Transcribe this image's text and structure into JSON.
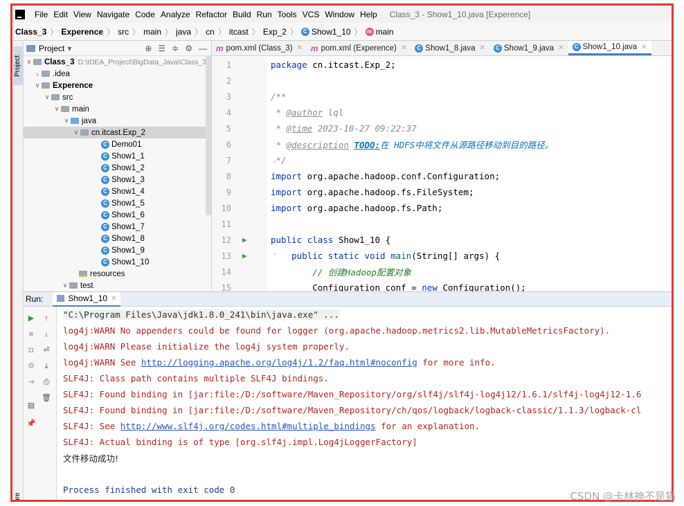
{
  "menubar": {
    "items": [
      "File",
      "Edit",
      "View",
      "Navigate",
      "Code",
      "Analyze",
      "Refactor",
      "Build",
      "Run",
      "Tools",
      "VCS",
      "Window",
      "Help"
    ],
    "window_title": "Class_3 - Show1_10.java [Experence]"
  },
  "navbar": {
    "crumbs": [
      "Class_3",
      "Experence",
      "src",
      "main",
      "java",
      "cn",
      "itcast",
      "Exp_2",
      "Show1_10",
      "main"
    ]
  },
  "sidestrip": {
    "top_label": "Project",
    "bottom_label": "ure"
  },
  "project": {
    "header": "Project",
    "dropdown": "▾",
    "tree": [
      {
        "label": "Class_3",
        "path": "D:\\IDEA_Project\\BigData_Java\\Class_3",
        "bold": true
      },
      {
        "label": ".idea"
      },
      {
        "label": "Experence",
        "bold": true
      },
      {
        "label": "src"
      },
      {
        "label": "main"
      },
      {
        "label": "java"
      },
      {
        "label": "cn.itcast.Exp_2"
      },
      {
        "label": "Demo01"
      },
      {
        "label": "Show1_1"
      },
      {
        "label": "Show1_2"
      },
      {
        "label": "Show1_3"
      },
      {
        "label": "Show1_4"
      },
      {
        "label": "Show1_5"
      },
      {
        "label": "Show1_6"
      },
      {
        "label": "Show1_7"
      },
      {
        "label": "Show1_8"
      },
      {
        "label": "Show1_9"
      },
      {
        "label": "Show1_10"
      },
      {
        "label": "resources"
      },
      {
        "label": "test"
      }
    ]
  },
  "editor": {
    "tabs": [
      {
        "label": "pom.xml (Class_3)",
        "icon": "m"
      },
      {
        "label": "pom.xml (Experence)",
        "icon": "m"
      },
      {
        "label": "Show1_8.java",
        "icon": "C"
      },
      {
        "label": "Show1_9.java",
        "icon": "C"
      },
      {
        "label": "Show1_10.java",
        "icon": "C"
      }
    ],
    "line_numbers": [
      "1",
      "2",
      "3",
      "4",
      "5",
      "6",
      "7",
      "8",
      "9",
      "10",
      "11",
      "12",
      "13",
      "14",
      "15"
    ],
    "code": {
      "l1_kw": "package",
      "l1_rest": " cn.itcast.Exp_2;",
      "l3": "/**",
      "l4_star": " * ",
      "l4_tag": "@author",
      "l4_val": " lql",
      "l5_tag": "@time",
      "l5_val": " 2023-10-27 09:22:37",
      "l6_tag": "@description",
      "l6_todo": "TODO:",
      "l6_text": "在 HDFS中将文件从源路径移动到目的路径。",
      "l7": " */",
      "l8_kw": "import",
      "l8_rest": " org.apache.hadoop.conf.Configuration;",
      "l9_kw": "import",
      "l9_rest": " org.apache.hadoop.fs.FileSystem;",
      "l10_kw": "import",
      "l10_rest": " org.apache.hadoop.fs.Path;",
      "l12_kw": "public class",
      "l12_rest": " Show1_10 {",
      "l13_kw": "public static void",
      "l13_fn": "main",
      "l13_rest": "(String[] args) {",
      "l14": "// 创建Hadoop配置对象",
      "l15_a": "Configuration conf = ",
      "l15_kw": "new",
      "l15_b": " Configuration();"
    }
  },
  "run": {
    "label": "Run:",
    "tab": "Show1_10",
    "lines": {
      "cmd": "\"C:\\Program Files\\Java\\jdk1.8.0_241\\bin\\java.exe\" ...",
      "w1": "log4j:WARN No appenders could be found for logger (org.apache.hadoop.metrics2.lib.MutableMetricsFactory).",
      "w2": "log4j:WARN Please initialize the log4j system properly.",
      "w3_a": "log4j:WARN See ",
      "w3_link": "http://logging.apache.org/log4j/1.2/faq.html#noconfig",
      "w3_b": " for more info.",
      "s1": "SLF4J: Class path contains multiple SLF4J bindings.",
      "s2": "SLF4J: Found binding in [jar:file:/D:/software/Maven_Repository/org/slf4j/slf4j-log4j12/1.6.1/slf4j-log4j12-1.6",
      "s3": "SLF4J: Found binding in [jar:file:/D:/software/Maven_Repository/ch/qos/logback/logback-classic/1.1.3/logback-cl",
      "s4_a": "SLF4J: See ",
      "s4_link": "http://www.slf4j.org/codes.html#multiple_bindings",
      "s4_b": " for an explanation.",
      "s5": "SLF4J: Actual binding is of type [org.slf4j.impl.Log4jLoggerFactory]",
      "ok": "文件移动成功!",
      "exit": "Process finished with exit code 0"
    }
  },
  "watermark": "CSDN @卡林神不是猫",
  "colors": {
    "frame": "#e53935",
    "keyword": "#0a33b3",
    "warn": "#b3261e",
    "link": "#2a55c8",
    "accent": "#4083c9"
  }
}
